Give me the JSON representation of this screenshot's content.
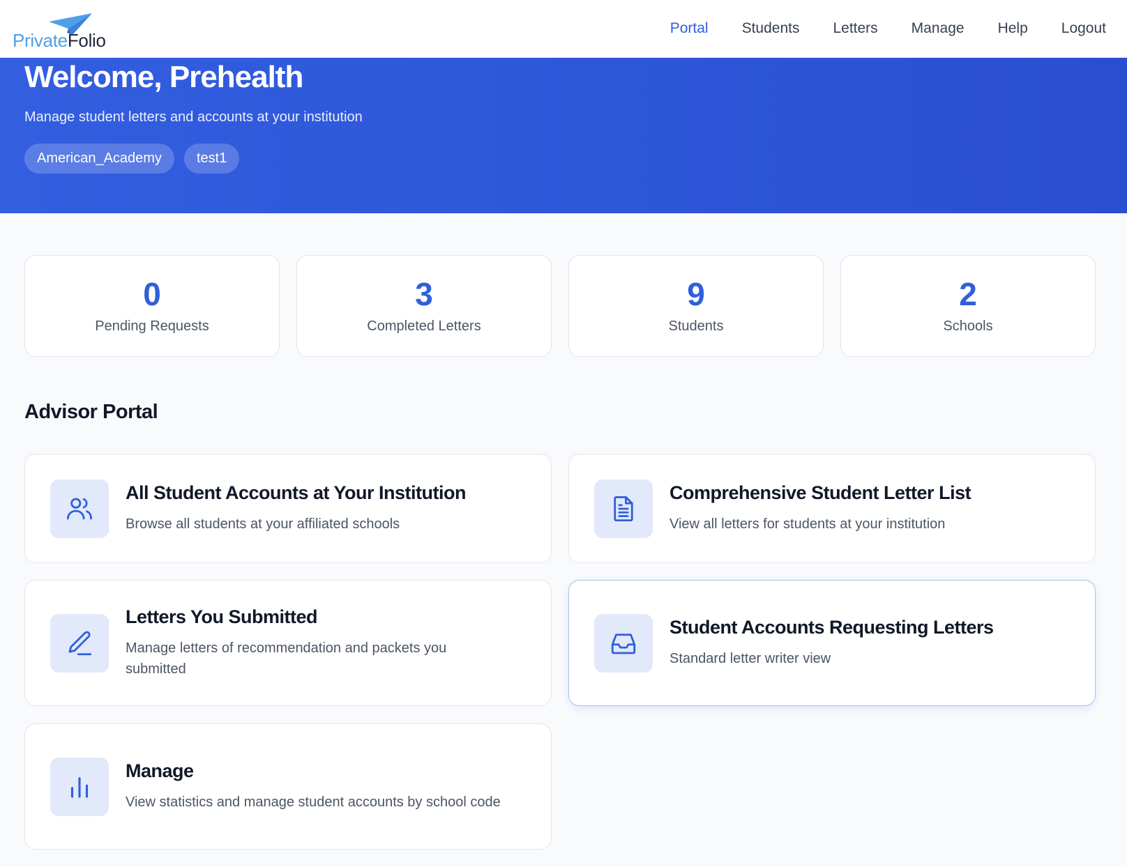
{
  "brand": {
    "part1": "Private",
    "part2": "Folio"
  },
  "nav": [
    {
      "label": "Portal",
      "active": true
    },
    {
      "label": "Students",
      "active": false
    },
    {
      "label": "Letters",
      "active": false
    },
    {
      "label": "Manage",
      "active": false
    },
    {
      "label": "Help",
      "active": false
    },
    {
      "label": "Logout",
      "active": false
    }
  ],
  "hero": {
    "title": "Welcome, Prehealth",
    "subtitle": "Manage student letters and accounts at your institution",
    "tags": [
      "American_Academy",
      "test1"
    ]
  },
  "stats": [
    {
      "value": "0",
      "label": "Pending Requests"
    },
    {
      "value": "3",
      "label": "Completed Letters"
    },
    {
      "value": "9",
      "label": "Students"
    },
    {
      "value": "2",
      "label": "Schools"
    }
  ],
  "section": {
    "title": "Advisor Portal"
  },
  "cards": [
    {
      "icon": "users-icon",
      "title": "All Student Accounts at Your Institution",
      "desc": "Browse all students at your affiliated schools"
    },
    {
      "icon": "document-icon",
      "title": "Comprehensive Student Letter List",
      "desc": "View all letters for students at your institution"
    },
    {
      "icon": "pen-icon",
      "title": "Letters You Submitted",
      "desc": "Manage letters of recommendation and packets you submitted"
    },
    {
      "icon": "inbox-icon",
      "title": "Student Accounts Requesting Letters",
      "desc": "Standard letter writer view"
    },
    {
      "icon": "bar-chart-icon",
      "title": "Manage",
      "desc": "View statistics and manage student accounts by school code"
    }
  ],
  "colors": {
    "accent": "#2f5fdc",
    "hero_bg": "#335ee0",
    "icon_bg": "#e1e9fb",
    "logo_blue": "#4f9fe8"
  }
}
